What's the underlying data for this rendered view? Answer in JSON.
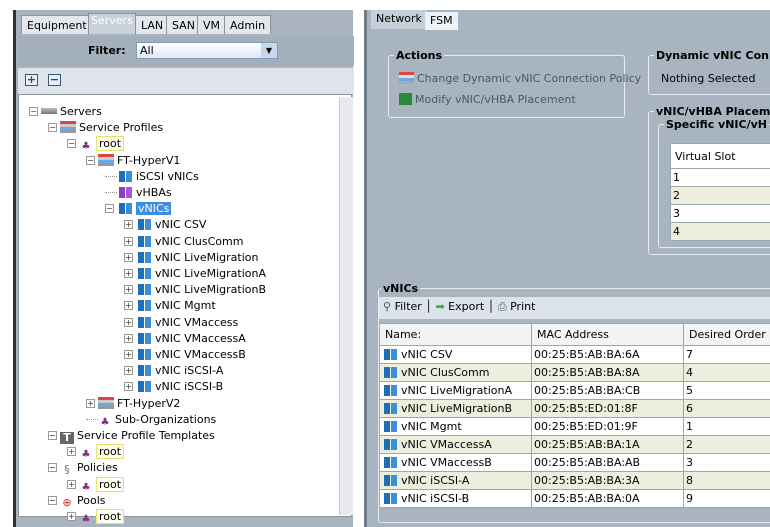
{
  "left": {
    "tabs": [
      "Equipment",
      "Servers",
      "LAN",
      "SAN",
      "VM",
      "Admin"
    ],
    "filter_label": "Filter:",
    "filter_value": "All",
    "tree": [
      {
        "label": "Servers",
        "lvl": 0,
        "exp": "-",
        "icon": "server"
      },
      {
        "label": "Service Profiles",
        "lvl": 1,
        "exp": "-",
        "icon": "profile"
      },
      {
        "label": "root",
        "lvl": 2,
        "exp": "-",
        "icon": "org",
        "boxed": true
      },
      {
        "label": "FT-HyperV1",
        "lvl": 3,
        "exp": "-",
        "icon": "profile"
      },
      {
        "label": "iSCSI vNICs",
        "lvl": 4,
        "exp": "",
        "icon": "nic"
      },
      {
        "label": "vHBAs",
        "lvl": 4,
        "exp": "",
        "icon": "hba"
      },
      {
        "label": "vNICs",
        "lvl": 4,
        "exp": "-",
        "icon": "nic",
        "selected": true
      },
      {
        "label": "vNIC CSV",
        "lvl": 5,
        "exp": "+",
        "icon": "nic"
      },
      {
        "label": "vNIC ClusComm",
        "lvl": 5,
        "exp": "+",
        "icon": "nic"
      },
      {
        "label": "vNIC LiveMigration",
        "lvl": 5,
        "exp": "+",
        "icon": "nic"
      },
      {
        "label": "vNIC LiveMigrationA",
        "lvl": 5,
        "exp": "+",
        "icon": "nic"
      },
      {
        "label": "vNIC LiveMigrationB",
        "lvl": 5,
        "exp": "+",
        "icon": "nic"
      },
      {
        "label": "vNIC Mgmt",
        "lvl": 5,
        "exp": "+",
        "icon": "nic"
      },
      {
        "label": "vNIC VMaccess",
        "lvl": 5,
        "exp": "+",
        "icon": "nic"
      },
      {
        "label": "vNIC VMaccessA",
        "lvl": 5,
        "exp": "+",
        "icon": "nic"
      },
      {
        "label": "vNIC VMaccessB",
        "lvl": 5,
        "exp": "+",
        "icon": "nic"
      },
      {
        "label": "vNIC iSCSI-A",
        "lvl": 5,
        "exp": "+",
        "icon": "nic"
      },
      {
        "label": "vNIC iSCSI-B",
        "lvl": 5,
        "exp": "+",
        "icon": "nic"
      },
      {
        "label": "FT-HyperV2",
        "lvl": 3,
        "exp": "+",
        "icon": "profile"
      },
      {
        "label": "Sub-Organizations",
        "lvl": 3,
        "exp": "",
        "icon": "org"
      },
      {
        "label": "Service Profile Templates",
        "lvl": 1,
        "exp": "-",
        "icon": "template"
      },
      {
        "label": "root",
        "lvl": 2,
        "exp": "+",
        "icon": "org",
        "boxed": true
      },
      {
        "label": "Policies",
        "lvl": 1,
        "exp": "-",
        "icon": "policy"
      },
      {
        "label": "root",
        "lvl": 2,
        "exp": "+",
        "icon": "org",
        "boxed": true
      },
      {
        "label": "Pools",
        "lvl": 1,
        "exp": "-",
        "icon": "pool"
      },
      {
        "label": "root",
        "lvl": 2,
        "exp": "+",
        "icon": "org",
        "boxed": true
      }
    ]
  },
  "right": {
    "tabs": [
      "Network",
      "FSM"
    ],
    "actions_title": "Actions",
    "actions": [
      "Change Dynamic vNIC Connection Policy",
      "Modify vNIC/vHBA Placement"
    ],
    "dynamic_title": "Dynamic vNIC Con",
    "dynamic_value": "Nothing Selected",
    "placement_title": "vNIC/vHBA Placem",
    "specific_title": "Specific vNIC/vH",
    "slot_header": "Virtual Slot",
    "slots": [
      "1",
      "2",
      "3",
      "4"
    ],
    "vnics_title": "vNICs",
    "toolbar": {
      "filter": "Filter",
      "export": "Export",
      "print": "Print"
    },
    "columns": [
      "Name:",
      "MAC Address",
      "Desired Order"
    ],
    "rows": [
      [
        "vNIC CSV",
        "00:25:B5:AB:BA:6A",
        "7"
      ],
      [
        "vNIC ClusComm",
        "00:25:B5:AB:BA:8A",
        "4"
      ],
      [
        "vNIC LiveMigrationA",
        "00:25:B5:AB:BA:CB",
        "5"
      ],
      [
        "vNIC LiveMigrationB",
        "00:25:B5:ED:01:8F",
        "6"
      ],
      [
        "vNIC Mgmt",
        "00:25:B5:ED:01:9F",
        "1"
      ],
      [
        "vNIC VMaccessA",
        "00:25:B5:AB:BA:1A",
        "2"
      ],
      [
        "vNIC VMaccessB",
        "00:25:B5:AB:BA:AB",
        "3"
      ],
      [
        "vNIC iSCSI-A",
        "00:25:B5:AB:BA:3A",
        "8"
      ],
      [
        "vNIC iSCSI-B",
        "00:25:B5:AB:BA:0A",
        "9"
      ]
    ]
  }
}
